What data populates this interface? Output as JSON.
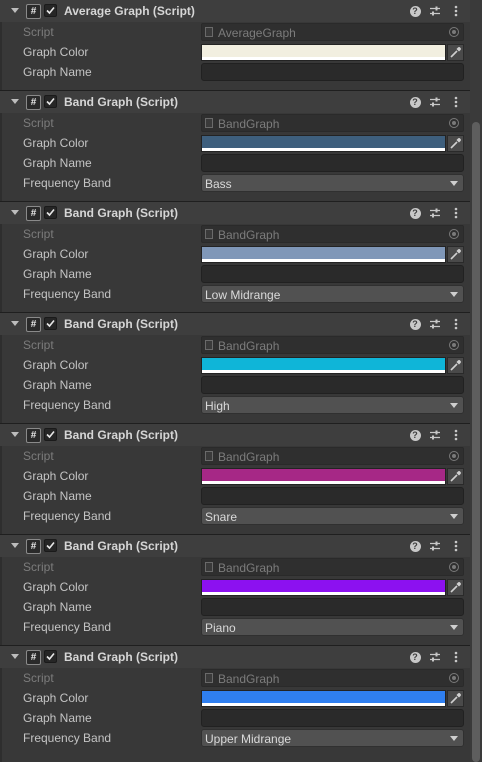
{
  "labels": {
    "script": "Script",
    "graph_color": "Graph Color",
    "graph_name": "Graph Name",
    "frequency_band": "Frequency Band"
  },
  "icons": {
    "component": "script-icon",
    "enabled": "checkbox-checked-icon",
    "help": "help-icon",
    "presets": "sliders-icon",
    "more": "kebab-menu-icon",
    "object_picker": "target-icon",
    "color_picker": "eyedropper-icon",
    "dropdown": "chevron-down-icon"
  },
  "components": [
    {
      "title": "Average Graph (Script)",
      "enabled": true,
      "script": "AverageGraph",
      "graph_color": "#f2efe0",
      "graph_name": "",
      "frequency_band": null
    },
    {
      "title": "Band Graph (Script)",
      "enabled": true,
      "script": "BandGraph",
      "graph_color": "#3e5f7d",
      "graph_name": "",
      "frequency_band": "Bass"
    },
    {
      "title": "Band Graph (Script)",
      "enabled": true,
      "script": "BandGraph",
      "graph_color": "#7f97b8",
      "graph_name": "",
      "frequency_band": "Low Midrange"
    },
    {
      "title": "Band Graph (Script)",
      "enabled": true,
      "script": "BandGraph",
      "graph_color": "#0fb5d8",
      "graph_name": "",
      "frequency_band": "High"
    },
    {
      "title": "Band Graph (Script)",
      "enabled": true,
      "script": "BandGraph",
      "graph_color": "#a62886",
      "graph_name": "",
      "frequency_band": "Snare"
    },
    {
      "title": "Band Graph (Script)",
      "enabled": true,
      "script": "BandGraph",
      "graph_color": "#8c11f0",
      "graph_name": "",
      "frequency_band": "Piano"
    },
    {
      "title": "Band Graph (Script)",
      "enabled": true,
      "script": "BandGraph",
      "graph_color": "#2f7ff0",
      "graph_name": "",
      "frequency_band": "Upper Midrange"
    }
  ]
}
